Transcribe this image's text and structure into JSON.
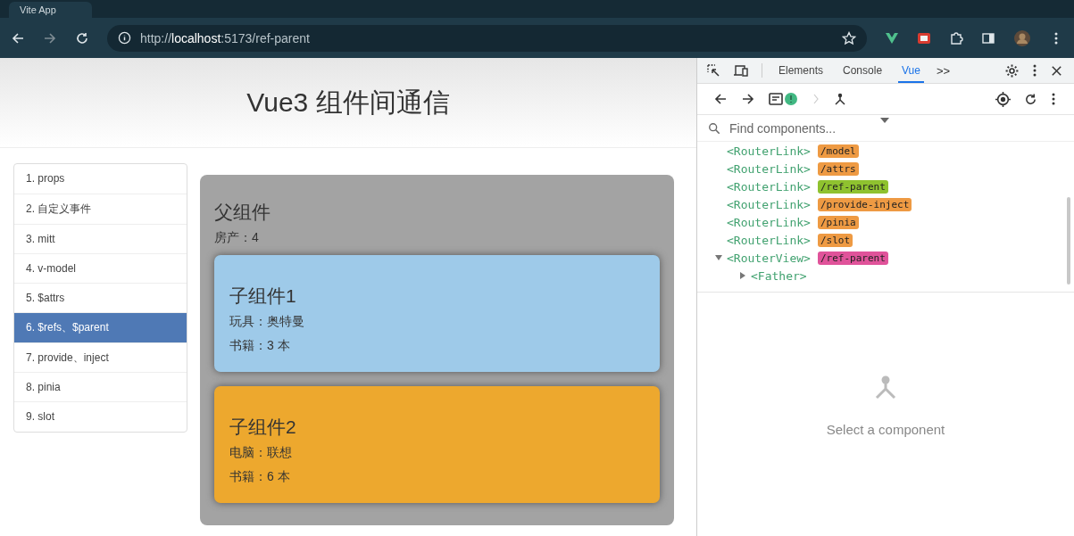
{
  "browser": {
    "tab_title": "Vite App",
    "url_host": "localhost",
    "url_rest": ":5173/ref-parent",
    "url_scheme": "http://"
  },
  "page": {
    "title": "Vue3 组件间通信",
    "nav": [
      {
        "label": "1. props",
        "selected": false
      },
      {
        "label": "2. 自定义事件",
        "selected": false
      },
      {
        "label": "3. mitt",
        "selected": false
      },
      {
        "label": "4. v-model",
        "selected": false
      },
      {
        "label": "5. $attrs",
        "selected": false
      },
      {
        "label": "6. $refs、$parent",
        "selected": true
      },
      {
        "label": "7. provide、inject",
        "selected": false
      },
      {
        "label": "8. pinia",
        "selected": false
      },
      {
        "label": "9. slot",
        "selected": false
      }
    ],
    "parent": {
      "title": "父组件",
      "lines": [
        "房产：4"
      ],
      "children": [
        {
          "title": "子组件1",
          "color": "#9ecae9",
          "lines": [
            "玩具：奥特曼",
            "书籍：3 本"
          ]
        },
        {
          "title": "子组件2",
          "color": "#eda82e",
          "lines": [
            "电脑：联想",
            "书籍：6 本"
          ]
        }
      ]
    }
  },
  "devtools": {
    "tabs": [
      {
        "label": "Elements",
        "selected": false
      },
      {
        "label": "Console",
        "selected": false
      },
      {
        "label": "Vue",
        "selected": true
      }
    ],
    "more": ">>",
    "search": {
      "placeholder": "Find components..."
    },
    "tree": [
      {
        "name": "<RouterLink>",
        "tag": "/model",
        "color": "#ee9a43"
      },
      {
        "name": "<RouterLink>",
        "tag": "/attrs",
        "color": "#ee9a43"
      },
      {
        "name": "<RouterLink>",
        "tag": "/ref-parent",
        "color": "#8fc22f"
      },
      {
        "name": "<RouterLink>",
        "tag": "/provide-inject",
        "color": "#ee9a43"
      },
      {
        "name": "<RouterLink>",
        "tag": "/pinia",
        "color": "#ee9a43"
      },
      {
        "name": "<RouterLink>",
        "tag": "/slot",
        "color": "#ee9a43"
      },
      {
        "name": "<RouterView>",
        "tag": "/ref-parent",
        "color": "#e0539a",
        "expanded": true,
        "children": [
          {
            "name": "<Father>",
            "expanded": false
          }
        ]
      }
    ],
    "empty_message": "Select a component"
  }
}
